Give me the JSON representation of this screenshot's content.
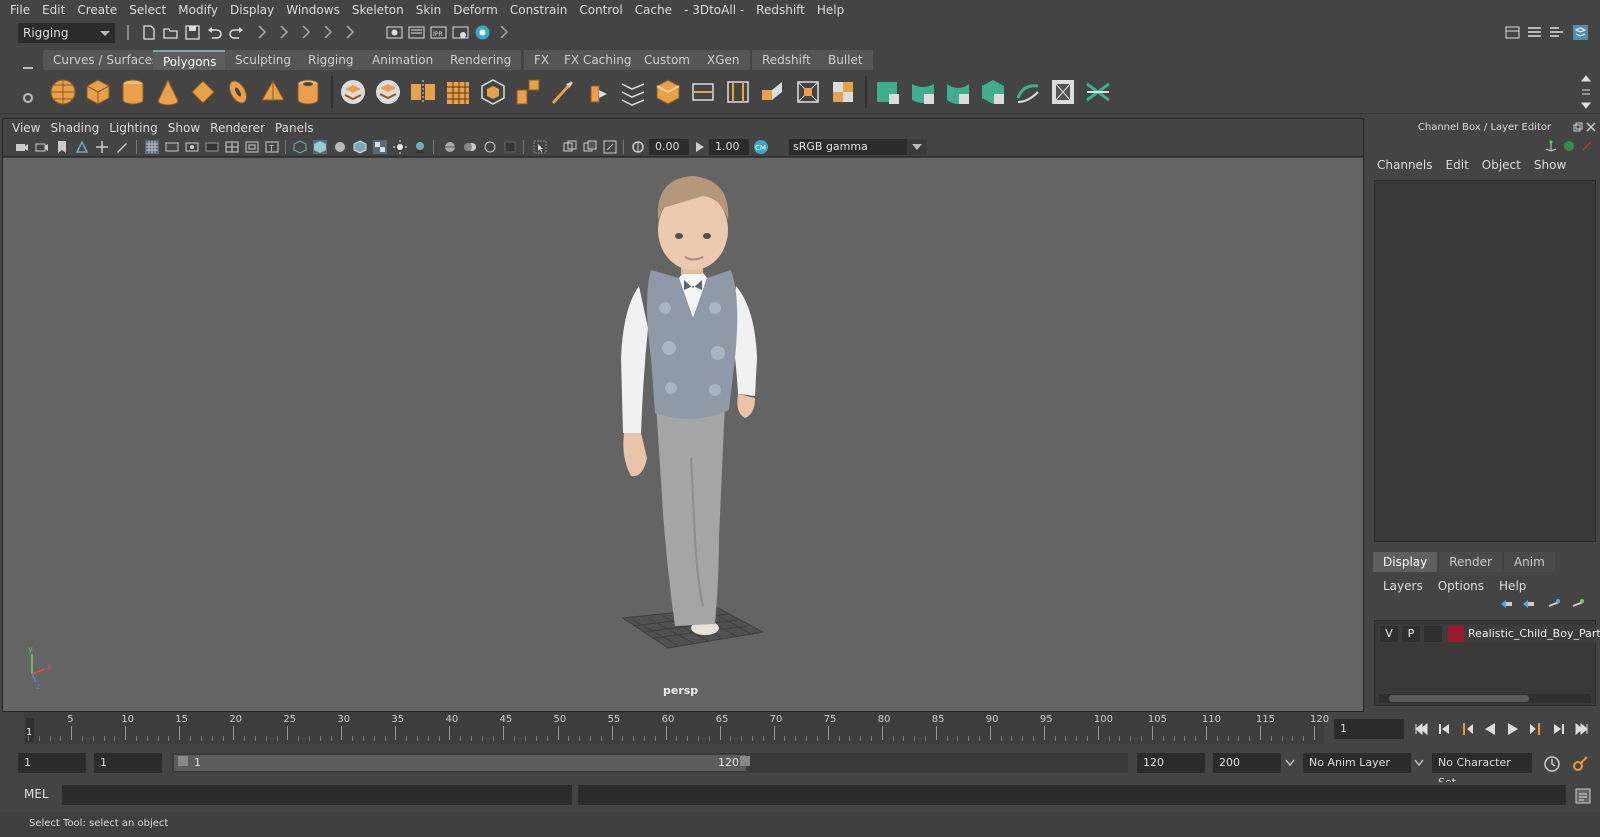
{
  "menubar": {
    "items": [
      "File",
      "Edit",
      "Create",
      "Select",
      "Modify",
      "Display",
      "Windows",
      "Skeleton",
      "Skin",
      "Deform",
      "Constrain",
      "Control",
      "Cache",
      "- 3DtoAll -",
      "Redshift",
      "Help"
    ]
  },
  "statusline": {
    "mode": "Rigging"
  },
  "shelf": {
    "tabs": [
      "Curves / Surfaces",
      "Polygons",
      "Sculpting",
      "Rigging",
      "Animation",
      "Rendering",
      "FX",
      "FX Caching",
      "Custom",
      "XGen",
      "Redshift",
      "Bullet"
    ],
    "active_tab": "Polygons"
  },
  "viewport": {
    "menu": [
      "View",
      "Shading",
      "Lighting",
      "Show",
      "Renderer",
      "Panels"
    ],
    "exposure": "0.00",
    "gamma": "1.00",
    "color_space": "sRGB gamma",
    "camera": "persp"
  },
  "right_panel": {
    "title": "Channel Box / Layer Editor",
    "channel_menu": [
      "Channels",
      "Edit",
      "Object",
      "Show"
    ],
    "tabs": [
      "Display",
      "Render",
      "Anim"
    ],
    "active_tab": "Display",
    "layer_menu": [
      "Layers",
      "Options",
      "Help"
    ],
    "layer": {
      "visible": "V",
      "playback": "P",
      "name": "Realistic_Child_Boy_Party",
      "color": "#9b1b2e"
    }
  },
  "timeslider": {
    "labels": [
      "5",
      "10",
      "15",
      "20",
      "25",
      "30",
      "35",
      "40",
      "45",
      "50",
      "55",
      "60",
      "65",
      "70",
      "75",
      "80",
      "85",
      "90",
      "95",
      "100",
      "105",
      "110",
      "115",
      "120"
    ],
    "current_frame_marker": "1",
    "current_frame": "1"
  },
  "range": {
    "start_frame": "1",
    "playback_start": "1",
    "range_start_label": "1",
    "range_end_label": "120",
    "playback_end": "120",
    "end_frame": "200",
    "anim_layer": "No Anim Layer",
    "character_set": "No Character Set"
  },
  "cmdline": {
    "label": "MEL"
  },
  "helpline": {
    "text": "Select Tool: select an object"
  },
  "colors": {
    "accent_teal": "#6cc3b4",
    "shelf_orange": "#e8a04a",
    "gamma_icon": "#3fa7c6"
  }
}
